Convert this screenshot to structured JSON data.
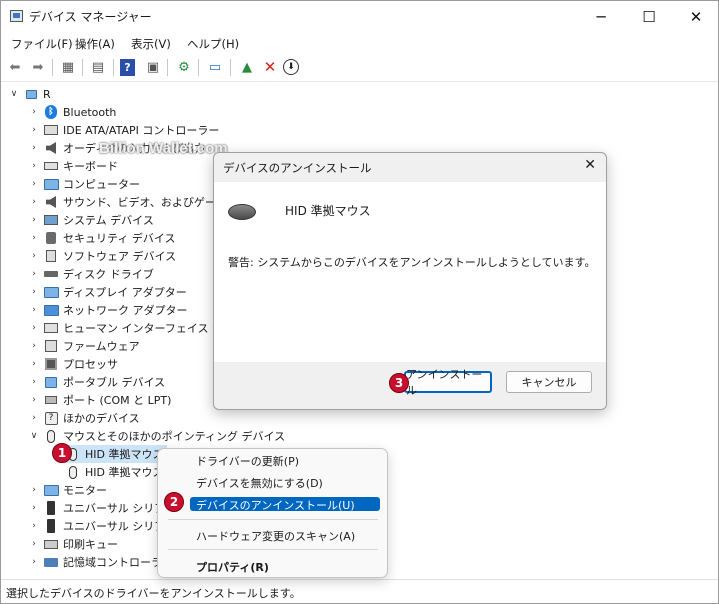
{
  "window": {
    "title": "デバイス マネージャー",
    "controls": {
      "minimize": "─",
      "maximize": "☐",
      "close": "✕"
    }
  },
  "menubar": [
    "ファイル(F)",
    "操作(A)",
    "表示(V)",
    "ヘルプ(H)"
  ],
  "toolbar": {
    "icons": [
      "back-icon",
      "forward-icon",
      "properties-grid-icon",
      "document-icon",
      "help-icon",
      "view-icon",
      "scan-icon",
      "monitor-icon",
      "update-driver-icon",
      "uninstall-icon",
      "disable-icon"
    ]
  },
  "tree": {
    "root": "R",
    "items": [
      {
        "label": "Bluetooth",
        "icon": "bluetooth-icon"
      },
      {
        "label": "IDE ATA/ATAPI コントローラー",
        "icon": "ide-icon"
      },
      {
        "label": "オーディオの入力および出力",
        "icon": "audio-icon"
      },
      {
        "label": "キーボード",
        "icon": "keyboard-icon"
      },
      {
        "label": "コンピューター",
        "icon": "computer-icon"
      },
      {
        "label": "サウンド、ビデオ、およびゲーム コントローラー",
        "icon": "sound-icon"
      },
      {
        "label": "システム デバイス",
        "icon": "system-icon"
      },
      {
        "label": "セキュリティ デバイス",
        "icon": "security-icon"
      },
      {
        "label": "ソフトウェア デバイス",
        "icon": "software-icon"
      },
      {
        "label": "ディスク ドライブ",
        "icon": "disk-icon"
      },
      {
        "label": "ディスプレイ アダプター",
        "icon": "display-icon"
      },
      {
        "label": "ネットワーク アダプター",
        "icon": "network-icon"
      },
      {
        "label": "ヒューマン インターフェイス デバイス",
        "icon": "hid-icon"
      },
      {
        "label": "ファームウェア",
        "icon": "firmware-icon"
      },
      {
        "label": "プロセッサ",
        "icon": "processor-icon"
      },
      {
        "label": "ポータブル デバイス",
        "icon": "portable-icon"
      },
      {
        "label": "ポート (COM と LPT)",
        "icon": "port-icon"
      },
      {
        "label": "ほかのデバイス",
        "icon": "other-icon"
      },
      {
        "label": "マウスとそのほかのポインティング デバイス",
        "icon": "mouse-icon"
      },
      {
        "label": "HID 準拠マウス",
        "icon": "mouse-icon"
      },
      {
        "label": "HID 準拠マウス",
        "icon": "mouse-icon"
      },
      {
        "label": "モニター",
        "icon": "monitor-icon"
      },
      {
        "label": "ユニバーサル シリアル バス コントローラー",
        "icon": "usb-icon"
      },
      {
        "label": "ユニバーサル シリアル バス デバイス",
        "icon": "usb-icon"
      },
      {
        "label": "印刷キュー",
        "icon": "printer-icon"
      },
      {
        "label": "記憶域コントローラー",
        "icon": "storage-icon"
      }
    ]
  },
  "watermark": "Billion Wallet.com",
  "dialog": {
    "title": "デバイスのアンインストール",
    "device_name": "HID 準拠マウス",
    "warning": "警告: システムからこのデバイスをアンインストールしようとしています。",
    "uninstall_button": "アンインストール",
    "cancel_button": "キャンセル"
  },
  "context_menu": {
    "items": [
      "ドライバーの更新(P)",
      "デバイスを無効にする(D)",
      "デバイスのアンインストール(U)",
      "ハードウェア変更のスキャン(A)",
      "プロパティ(R)"
    ],
    "highlighted_index": 2
  },
  "badges": [
    "1",
    "2",
    "3"
  ],
  "statusbar": {
    "text": "選択したデバイスのドライバーをアンインストールします。"
  },
  "colors": {
    "accent": "#0067c0",
    "badge": "#c8102e",
    "selection": "#cce4f7"
  }
}
